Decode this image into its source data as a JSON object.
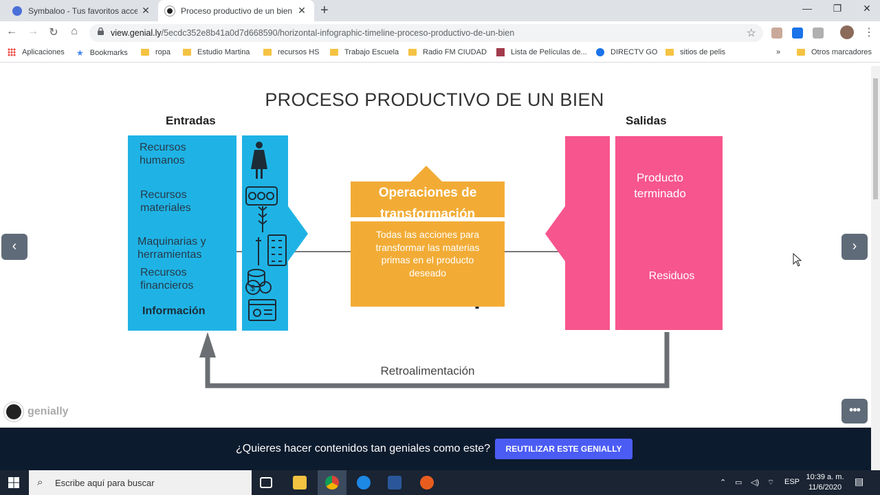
{
  "browser": {
    "tabs": [
      {
        "title": "Symbaloo - Tus favoritos accesibles",
        "active": false
      },
      {
        "title": "Proceso productivo de un bien por",
        "active": true
      }
    ],
    "new_tab": "+",
    "url_domain": "view.genial.ly",
    "url_path": "/5ecdc352e8b41a0d7d668590/horizontal-infographic-timeline-proceso-productivo-de-un-bien",
    "bookmarks": [
      "Aplicaciones",
      "Bookmarks",
      "ropa",
      "Estudio Martina",
      "recursos HS",
      "Trabajo Escuela",
      "Radio FM CIUDAD",
      "Lista de Películas de...",
      "DIRECTV GO",
      "sitios de pelis"
    ],
    "bookmarks_overflow": "»",
    "other_bookmarks": "Otros marcadores"
  },
  "infographic": {
    "title": "PROCESO PRODUCTIVO DE UN BIEN",
    "inputs_heading": "Entradas",
    "outputs_heading": "Salidas",
    "inputs": [
      "Recursos humanos",
      "Recursos materiales",
      "Maquinarias y herramientas",
      "Recursos financieros",
      "Información"
    ],
    "process_title": "Operaciones de transformación",
    "process_description": "Todas las acciones para transformar las materias primas en el producto deseado",
    "output_product": "Producto terminado",
    "output_waste": "Residuos",
    "feedback": "Retroalimentación",
    "colors": {
      "inputs": "#1fb3e5",
      "process": "#f2ac36",
      "outputs": "#f7558e",
      "arrow": "#6b6f73"
    }
  },
  "genially": {
    "logo_text": "genially",
    "cta_text": "¿Quieres hacer contenidos tan geniales como este?",
    "cta_button": "REUTILIZAR ESTE GENIALLY",
    "prev": "‹",
    "next": "›",
    "more": "•••"
  },
  "taskbar": {
    "search_placeholder": "Escribe aquí para buscar",
    "language": "ESP",
    "time": "10:39 a. m.",
    "date": "11/6/2020"
  }
}
